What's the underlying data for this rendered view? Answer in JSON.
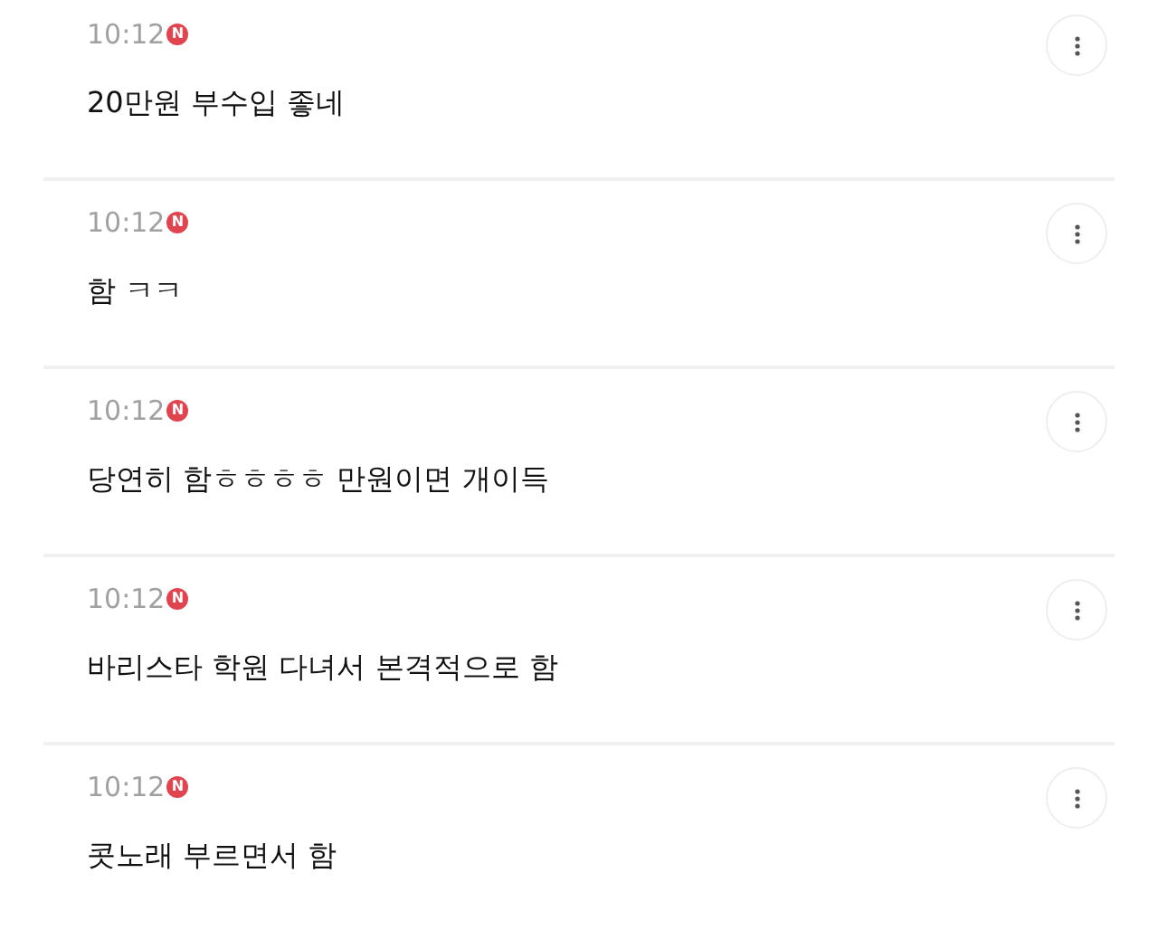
{
  "comments": [
    {
      "time": "10:12",
      "badge": "N",
      "text": "20만원 부수입 좋네"
    },
    {
      "time": "10:12",
      "badge": "N",
      "text": "함 ㅋㅋ"
    },
    {
      "time": "10:12",
      "badge": "N",
      "text": "당연히 함ㅎㅎㅎㅎ 만원이면 개이득"
    },
    {
      "time": "10:12",
      "badge": "N",
      "text": "바리스타 학원 다녀서 본격적으로 함"
    },
    {
      "time": "10:12",
      "badge": "N",
      "text": "콧노래 부르면서 함"
    }
  ]
}
